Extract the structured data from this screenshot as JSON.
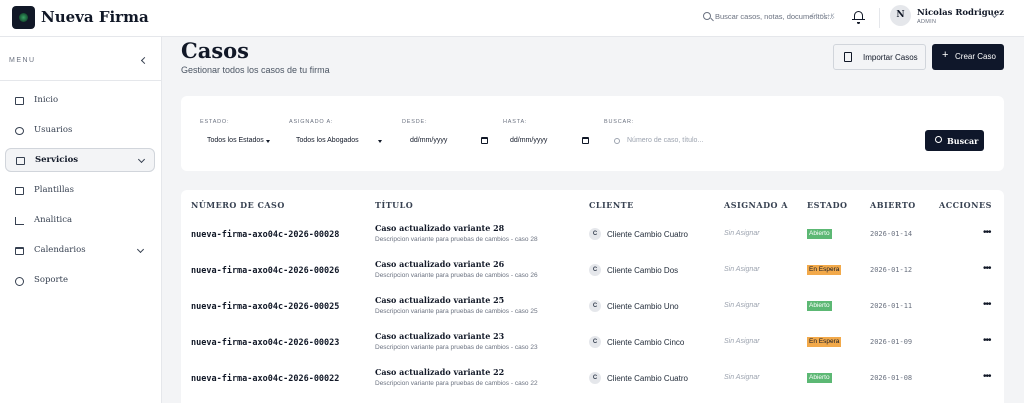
{
  "app": {
    "brand": "Nueva Firma"
  },
  "topbar": {
    "search_placeholder": "Buscar casos, notas, documentos...",
    "search_shortcut": "Ctrl+K",
    "user": {
      "initial": "N",
      "name": "Nicolas Rodriguez",
      "role": "ADMIN"
    }
  },
  "sidebar": {
    "menu_label": "MENU",
    "items": [
      {
        "label": "Inicio",
        "icon": "home-icon",
        "active": false,
        "expandable": false
      },
      {
        "label": "Usuarios",
        "icon": "users-icon",
        "active": false,
        "expandable": false
      },
      {
        "label": "Servicios",
        "icon": "briefcase-icon",
        "active": true,
        "expandable": true
      },
      {
        "label": "Plantillas",
        "icon": "document-icon",
        "active": false,
        "expandable": false
      },
      {
        "label": "Analitica",
        "icon": "chart-icon",
        "active": false,
        "expandable": false
      },
      {
        "label": "Calendarios",
        "icon": "calendar-icon",
        "active": false,
        "expandable": true
      },
      {
        "label": "Soporte",
        "icon": "support-icon",
        "active": false,
        "expandable": false
      }
    ]
  },
  "page": {
    "title": "Casos",
    "subtitle": "Gestionar todos los casos de tu firma",
    "import_label": "Importar Casos",
    "create_label": "Crear Caso"
  },
  "filters": {
    "estado_label": "ESTADO:",
    "estado_value": "Todos los Estados",
    "asignado_label": "ASIGNADO A:",
    "asignado_value": "Todos los Abogados",
    "desde_label": "DESDE:",
    "desde_value": "dd/mm/yyyy",
    "hasta_label": "HASTA:",
    "hasta_value": "dd/mm/yyyy",
    "buscar_label": "BUSCAR:",
    "buscar_placeholder": "Número de caso, título...",
    "buscar_button": "Buscar"
  },
  "table": {
    "headers": [
      "NÚMERO DE CASO",
      "TÍTULO",
      "CLIENTE",
      "ASIGNADO A",
      "ESTADO",
      "ABIERTO",
      "ACCIONES"
    ],
    "rows": [
      {
        "number": "nueva-firma-axo04c-2026-00028",
        "title": "Caso actualizado variante 28",
        "desc": "Descripcion variante para pruebas de cambios - caso 28",
        "client_initial": "C",
        "client": "Cliente Cambio Cuatro",
        "assigned": "Sin Asignar",
        "status": "Abierto",
        "status_kind": "open",
        "opened": "2026-01-14"
      },
      {
        "number": "nueva-firma-axo04c-2026-00026",
        "title": "Caso actualizado variante 26",
        "desc": "Descripcion variante para pruebas de cambios - caso 26",
        "client_initial": "C",
        "client": "Cliente Cambio Dos",
        "assigned": "Sin Asignar",
        "status": "En Espera",
        "status_kind": "wait",
        "opened": "2026-01-12"
      },
      {
        "number": "nueva-firma-axo04c-2026-00025",
        "title": "Caso actualizado variante 25",
        "desc": "Descripcion variante para pruebas de cambios - caso 25",
        "client_initial": "C",
        "client": "Cliente Cambio Uno",
        "assigned": "Sin Asignar",
        "status": "Abierto",
        "status_kind": "open",
        "opened": "2026-01-11"
      },
      {
        "number": "nueva-firma-axo04c-2026-00023",
        "title": "Caso actualizado variante 23",
        "desc": "Descripcion variante para pruebas de cambios - caso 23",
        "client_initial": "C",
        "client": "Cliente Cambio Cinco",
        "assigned": "Sin Asignar",
        "status": "En Espera",
        "status_kind": "wait",
        "opened": "2026-01-09"
      },
      {
        "number": "nueva-firma-axo04c-2026-00022",
        "title": "Caso actualizado variante 22",
        "desc": "Descripcion variante para pruebas de cambios - caso 22",
        "client_initial": "C",
        "client": "Cliente Cambio Cuatro",
        "assigned": "Sin Asignar",
        "status": "Abierto",
        "status_kind": "open",
        "opened": "2026-01-08"
      }
    ]
  },
  "colors": {
    "primary": "#0f172a",
    "status_open": "#5cb874",
    "status_wait": "#f2a94a"
  }
}
